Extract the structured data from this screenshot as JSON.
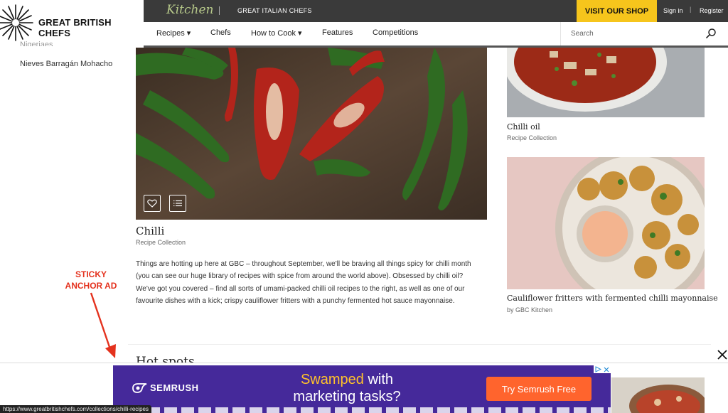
{
  "header": {
    "logo_text": "GREAT BRITISH CHEFS",
    "kitchen_label": "Kitchen",
    "italian_label": "GREAT ITALIAN CHEFS",
    "shop_label": "VISIT OUR SHOP",
    "signin_label": "Sign in",
    "separator": "|",
    "register_label": "Register",
    "nav": [
      {
        "label": "Recipes ▾"
      },
      {
        "label": "Chefs"
      },
      {
        "label": "How to Cook ▾"
      },
      {
        "label": "Features"
      },
      {
        "label": "Competitions"
      }
    ],
    "search_placeholder": "Search"
  },
  "sidebar": {
    "cut_label": "Nigeriaes",
    "chef_name": "Nieves Barragán Mohacho"
  },
  "main": {
    "title": "Chilli",
    "subtitle": "Recipe Collection",
    "description": "Things are hotting up here at GBC – throughout September, we'll be braving all things spicy for chilli month (you can see our huge library of recipes with spice from around the world above). Obsessed by chilli oil? We've got you covered – find all sorts of umami-packed chilli oil recipes to the right, as well as one of our favourite dishes with a kick; crispy cauliflower fritters with a punchy fermented hot sauce mayonnaise."
  },
  "right_cards": [
    {
      "title": "Chilli oil",
      "subtitle": "Recipe Collection"
    },
    {
      "title": "Cauliflower fritters with fermented chilli mayonnaise",
      "subtitle": "by GBC Kitchen"
    }
  ],
  "hot_spots": {
    "title": "Hot spots"
  },
  "annotation": {
    "line1": "STICKY",
    "line2": "ANCHOR AD"
  },
  "ad": {
    "brand": "SEMRUSH",
    "headline_highlight": "Swamped",
    "headline_rest1": " with",
    "headline_line2": "marketing tasks?",
    "cta": "Try Semrush Free"
  },
  "status_url": "https://www.greatbritishchefs.com/collections/chilli-recipes",
  "colors": {
    "topbar": "#3a3a3a",
    "shop_button": "#f6c51c",
    "annotation": "#e4321e",
    "ad_background": "#45299a",
    "ad_cta": "#ff642d",
    "ad_highlight": "#ffc22b"
  }
}
